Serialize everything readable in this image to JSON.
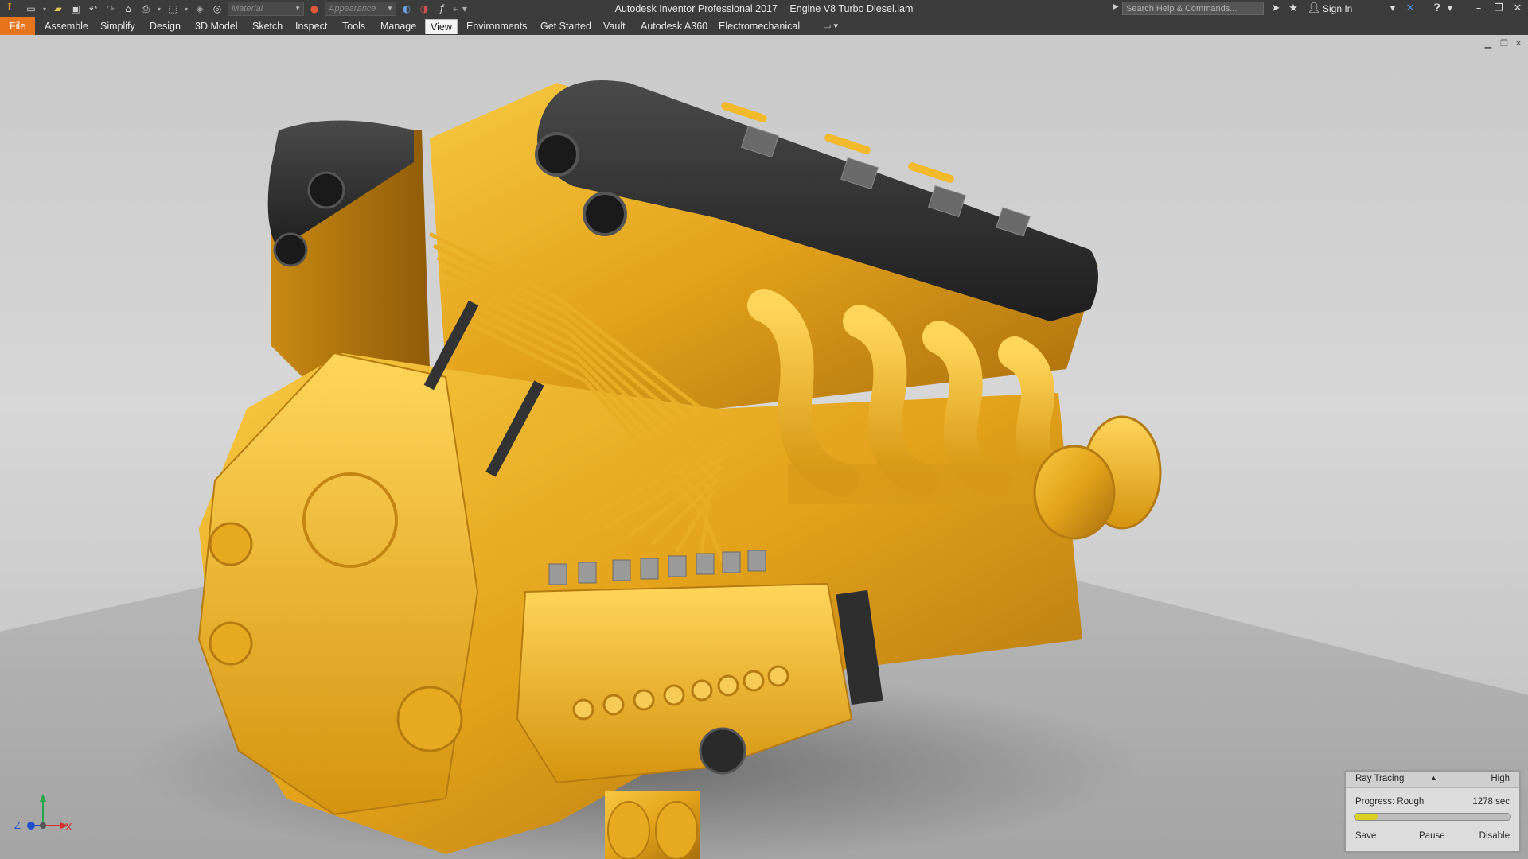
{
  "window": {
    "app_title": "Autodesk Inventor Professional 2017",
    "document_title": "Engine V8 Turbo Diesel.iam",
    "logo_text": "I",
    "material_placeholder": "Material",
    "appearance_placeholder": "Appearance",
    "search_placeholder": "Search Help & Commands...",
    "sign_in": "Sign In"
  },
  "ribbon": {
    "tabs": [
      {
        "label": "File"
      },
      {
        "label": "Assemble"
      },
      {
        "label": "Simplify"
      },
      {
        "label": "Design"
      },
      {
        "label": "3D Model"
      },
      {
        "label": "Sketch"
      },
      {
        "label": "Inspect"
      },
      {
        "label": "Tools"
      },
      {
        "label": "Manage"
      },
      {
        "label": "View"
      },
      {
        "label": "Environments"
      },
      {
        "label": "Get Started"
      },
      {
        "label": "Vault"
      },
      {
        "label": "Autodesk A360"
      },
      {
        "label": "Electromechanical"
      }
    ],
    "active_tab": "View"
  },
  "triad": {
    "z": "Z",
    "x": "X"
  },
  "ray_tracing": {
    "title": "Ray Tracing",
    "quality": "High",
    "progress_label": "Progress: Rough",
    "elapsed": "1278 sec",
    "progress_fraction": 0.15,
    "save": "Save",
    "pause": "Pause",
    "disable": "Disable"
  },
  "colors": {
    "accent_file_tab": "#e8741b",
    "engine_yellow": "#e6a91f",
    "valve_cover": "#2b2b2b",
    "progress_fill": "#d8cf20"
  }
}
